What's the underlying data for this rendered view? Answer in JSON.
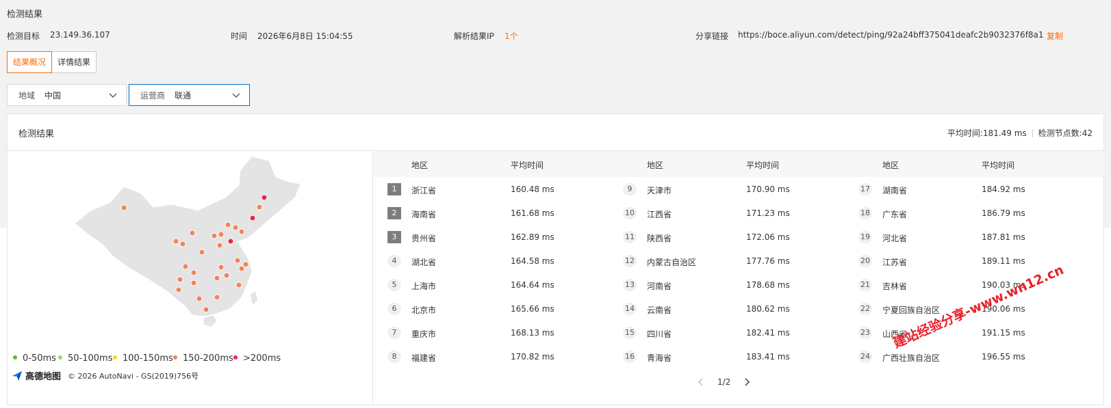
{
  "page": {
    "title": "检测结果",
    "target_label": "检测目标",
    "target_value": "23.149.36.107",
    "time_label": "时间",
    "time_value": "2026年6月8日 15:04:55",
    "resolve_label": "解析结果IP",
    "resolve_count": "1个",
    "share_label": "分享链接",
    "share_url": "https://boce.aliyun.com/detect/ping/92a24bff375041deafc2b9032376f8a1",
    "copy_label": "复制"
  },
  "tabs": [
    {
      "label": "结果概况",
      "active": true
    },
    {
      "label": "详情结果",
      "active": false
    }
  ],
  "filters": {
    "region_label": "地域",
    "region_value": "中国",
    "isp_label": "运营商",
    "isp_value": "联通"
  },
  "panel": {
    "title": "检测结果",
    "avg_time_text": "平均时间:181.49 ms",
    "node_count_text": "检测节点数:42"
  },
  "table": {
    "headers": {
      "region": "地区",
      "avg": "平均时间"
    },
    "rows": [
      {
        "rank": "1",
        "region": "浙江省",
        "time": "160.48 ms"
      },
      {
        "rank": "2",
        "region": "海南省",
        "time": "161.68 ms"
      },
      {
        "rank": "3",
        "region": "贵州省",
        "time": "162.89 ms"
      },
      {
        "rank": "4",
        "region": "湖北省",
        "time": "164.58 ms"
      },
      {
        "rank": "5",
        "region": "上海市",
        "time": "164.64 ms"
      },
      {
        "rank": "6",
        "region": "北京市",
        "time": "165.66 ms"
      },
      {
        "rank": "7",
        "region": "重庆市",
        "time": "168.13 ms"
      },
      {
        "rank": "8",
        "region": "福建省",
        "time": "170.82 ms"
      },
      {
        "rank": "9",
        "region": "天津市",
        "time": "170.90 ms"
      },
      {
        "rank": "10",
        "region": "江西省",
        "time": "171.23 ms"
      },
      {
        "rank": "11",
        "region": "陕西省",
        "time": "172.06 ms"
      },
      {
        "rank": "12",
        "region": "内蒙古自治区",
        "time": "177.76 ms"
      },
      {
        "rank": "13",
        "region": "河南省",
        "time": "178.68 ms"
      },
      {
        "rank": "14",
        "region": "云南省",
        "time": "180.62 ms"
      },
      {
        "rank": "15",
        "region": "四川省",
        "time": "182.41 ms"
      },
      {
        "rank": "16",
        "region": "青海省",
        "time": "183.41 ms"
      },
      {
        "rank": "17",
        "region": "湖南省",
        "time": "184.92 ms"
      },
      {
        "rank": "18",
        "region": "广东省",
        "time": "186.79 ms"
      },
      {
        "rank": "19",
        "region": "河北省",
        "time": "187.81 ms"
      },
      {
        "rank": "20",
        "region": "江苏省",
        "time": "189.11 ms"
      },
      {
        "rank": "21",
        "region": "吉林省",
        "time": "190.03 ms"
      },
      {
        "rank": "22",
        "region": "宁夏回族自治区",
        "time": "190.06 ms"
      },
      {
        "rank": "23",
        "region": "山西省",
        "time": "191.15 ms"
      },
      {
        "rank": "24",
        "region": "广西壮族自治区",
        "time": "196.55 ms"
      }
    ]
  },
  "pagination": {
    "text": "1/2"
  },
  "legend": [
    {
      "label": "0-50ms",
      "color": "#52c41a"
    },
    {
      "label": "50-100ms",
      "color": "#95de64"
    },
    {
      "label": "100-150ms",
      "color": "#fadb14"
    },
    {
      "label": "150-200ms",
      "color": "#f0845a"
    },
    {
      "label": ">200ms",
      "color": "#e8284a"
    }
  ],
  "map": {
    "logo_text": "高德地图",
    "copyright": "© 2026 AutoNavi - GS(2019)756号",
    "fill_color": "#e4e4e4",
    "dot_color_mid": "#f0845a",
    "dot_color_high": "#e8284a"
  },
  "watermark": "建站经验分享-www.wn12.cn"
}
